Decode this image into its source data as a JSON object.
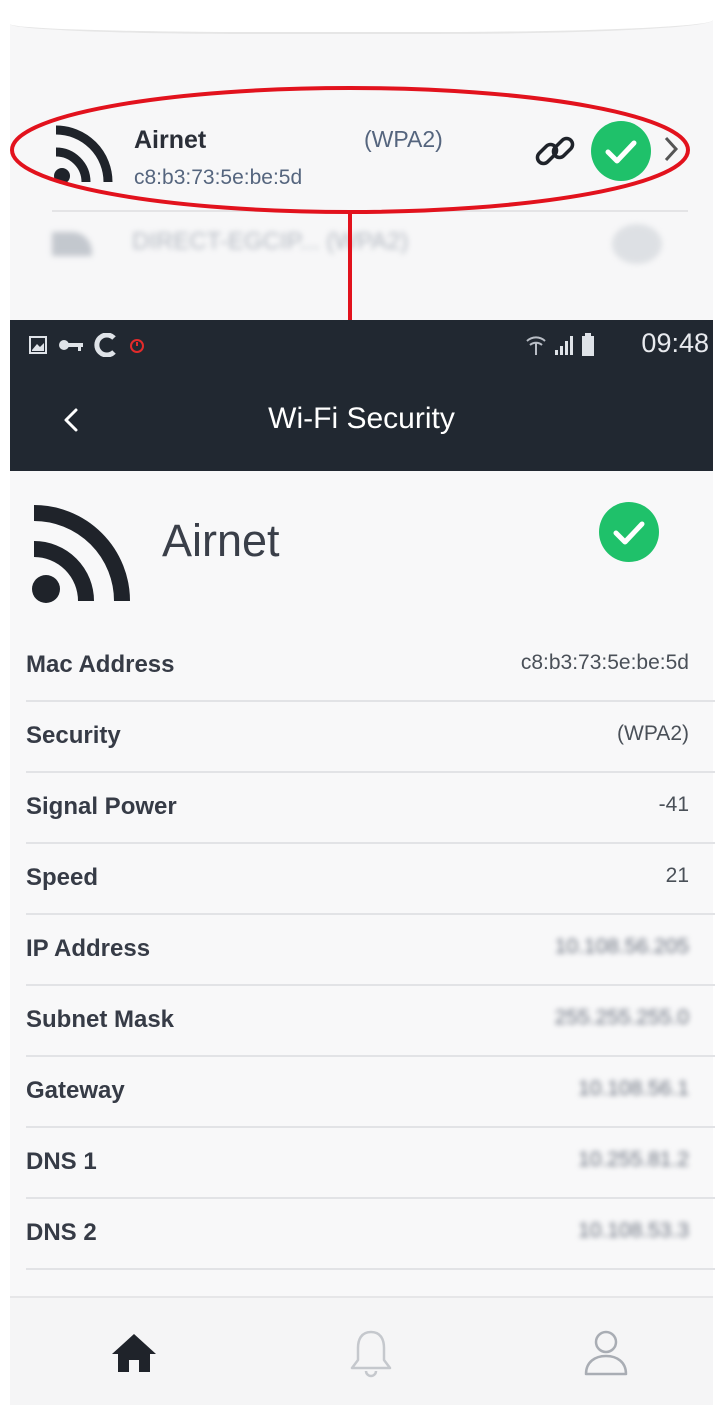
{
  "network_list": {
    "selected": {
      "name": "Airnet",
      "mac": "c8:b3:73:5e:be:5d",
      "security": "(WPA2)"
    },
    "next_row_partial": "DIRECT-EGCIP... (WPA2)"
  },
  "status_bar": {
    "time": "09:48"
  },
  "app_bar": {
    "title": "Wi-Fi Security"
  },
  "network": {
    "name": "Airnet"
  },
  "details": [
    {
      "label": "Mac Address",
      "value": "c8:b3:73:5e:be:5d",
      "blurred": false
    },
    {
      "label": "Security",
      "value": "(WPA2)",
      "blurred": false
    },
    {
      "label": "Signal Power",
      "value": "-41",
      "blurred": false
    },
    {
      "label": "Speed",
      "value": "21",
      "blurred": false
    },
    {
      "label": "IP Address",
      "value": "10.108.56.205",
      "blurred": true
    },
    {
      "label": "Subnet Mask",
      "value": "255.255.255.0",
      "blurred": true
    },
    {
      "label": "Gateway",
      "value": "10.108.56.1",
      "blurred": true
    },
    {
      "label": "DNS 1",
      "value": "10.255.81.2",
      "blurred": true
    },
    {
      "label": "DNS 2",
      "value": "10.108.53.3",
      "blurred": true
    }
  ],
  "colors": {
    "accent_green": "#1fc16a",
    "annotation_red": "#e2121d",
    "app_bar_bg": "#212831"
  },
  "icons": {
    "wifi": "wifi-signal-icon",
    "link": "link-icon",
    "check": "check-circle-icon",
    "back": "back-arrow-icon",
    "home": "home-icon",
    "bell": "bell-icon",
    "user": "user-icon"
  }
}
